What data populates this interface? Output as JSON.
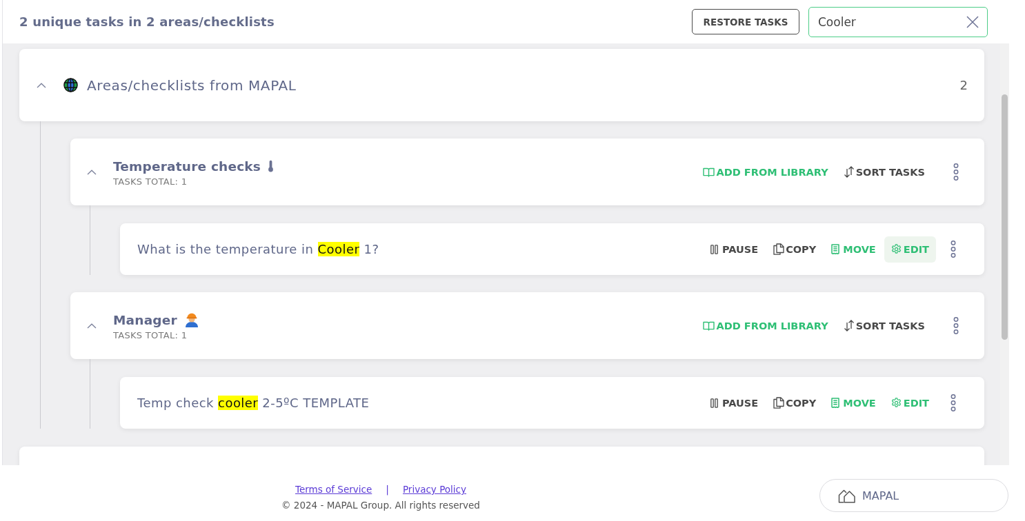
{
  "header": {
    "summary": "2 unique tasks in 2 areas/checklists",
    "restore_button": "RESTORE TASKS",
    "search": {
      "value": "Cooler",
      "focused": true
    }
  },
  "areas": [
    {
      "title": "Areas/checklists from MAPAL",
      "count": "2",
      "expanded": true,
      "checklists": [
        {
          "title": "Temperature checks",
          "kind": "thermometer",
          "tasks_total": "TASKS TOTAL: 1",
          "expanded": true,
          "actions": [
            {
              "label": "ADD FROM LIBRARY",
              "kind": "library",
              "hovered": false
            },
            {
              "label": "SORT TASKS",
              "kind": "sort",
              "hovered": false
            }
          ],
          "tasks": [
            {
              "title_parts": [
                {
                  "text": "What is the temperature in ",
                  "highlighted": false
                },
                {
                  "text": "Cooler",
                  "highlighted": true
                },
                {
                  "text": " 1?",
                  "highlighted": false
                }
              ],
              "actions": [
                {
                  "label": "PAUSE",
                  "kind": "pause",
                  "hovered": false
                },
                {
                  "label": "COPY",
                  "kind": "copy",
                  "hovered": false
                },
                {
                  "label": "MOVE",
                  "kind": "move",
                  "hovered": false
                },
                {
                  "label": "EDIT",
                  "kind": "edit",
                  "hovered": true
                }
              ]
            }
          ]
        },
        {
          "title": "Manager",
          "kind": "worker",
          "tasks_total": "TASKS TOTAL: 1",
          "expanded": true,
          "actions": [
            {
              "label": "ADD FROM LIBRARY",
              "kind": "library",
              "hovered": false
            },
            {
              "label": "SORT TASKS",
              "kind": "sort",
              "hovered": false
            }
          ],
          "tasks": [
            {
              "title_parts": [
                {
                  "text": "Temp check ",
                  "highlighted": false
                },
                {
                  "text": "cooler",
                  "highlighted": true
                },
                {
                  "text": " 2-5ºC TEMPLATE",
                  "highlighted": false
                }
              ],
              "actions": [
                {
                  "label": "PAUSE",
                  "kind": "pause",
                  "hovered": false
                },
                {
                  "label": "COPY",
                  "kind": "copy",
                  "hovered": false
                },
                {
                  "label": "MOVE",
                  "kind": "move",
                  "hovered": false
                },
                {
                  "label": "EDIT",
                  "kind": "edit",
                  "hovered": false
                }
              ]
            }
          ]
        }
      ]
    }
  ],
  "footer": {
    "links": [
      "Terms of Service",
      "Privacy Policy"
    ],
    "separator": "|",
    "copyright": "© 2024 - MAPAL Group. All rights reserved",
    "brand_button": "MAPAL"
  }
}
